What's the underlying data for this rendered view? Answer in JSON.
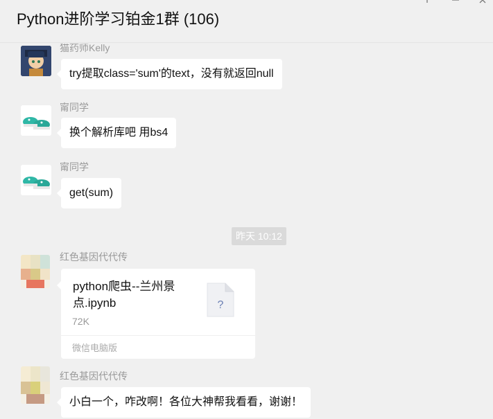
{
  "window": {
    "title": "Python进阶学习铂金1群 (106)",
    "pin_icon": "pin-icon",
    "minimize_icon": "minimize-icon",
    "close_icon": "close-icon"
  },
  "messages": [
    {
      "sender": "猫药师Kelly",
      "text": "try提取class='sum'的text，没有就返回null",
      "avatar_icon": "cartoon-girl-avatar"
    },
    {
      "sender": "甯同学",
      "text": "换个解析库吧 用bs4",
      "avatar_icon": "green-shoes-avatar"
    },
    {
      "sender": "甯同学",
      "text": "get(sum)",
      "avatar_icon": "green-shoes-avatar"
    }
  ],
  "timestamp": "昨天 10:12",
  "file_message": {
    "sender": "红色基因代代传",
    "file_name": "python爬虫--兰州景点.ipynb",
    "file_size": "72K",
    "source": "微信电脑版",
    "icon": "unknown-file-icon",
    "icon_glyph": "?"
  },
  "last_message": {
    "sender": "红色基因代代传",
    "text": "小白一个，咋改啊！各位大神帮我看看，谢谢！"
  }
}
